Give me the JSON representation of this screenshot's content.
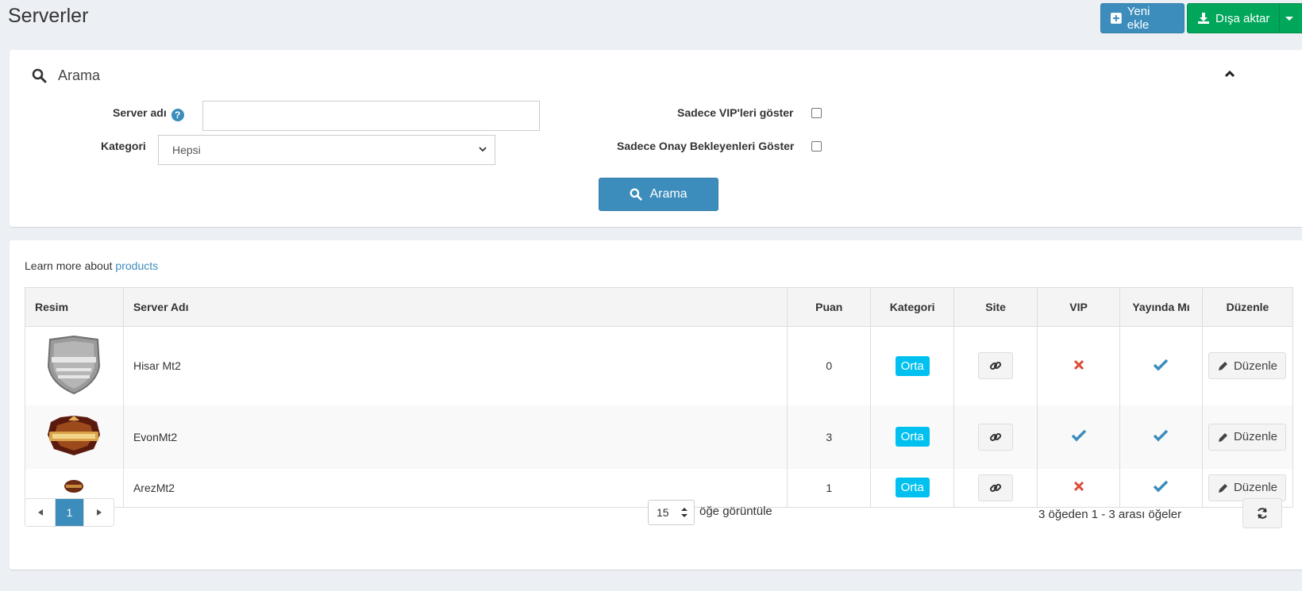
{
  "header": {
    "title": "Serverler",
    "new_button": "Yeni ekle",
    "export_button": "Dışa aktar"
  },
  "search": {
    "title": "Arama",
    "server_name_label": "Server adı",
    "server_name_value": "",
    "category_label": "Kategori",
    "category_selected": "Hepsi",
    "vip_only_label": "Sadece VIP'leri göster",
    "pending_only_label": "Sadece Onay Bekleyenleri Göster",
    "search_button": "Arama"
  },
  "list": {
    "learn_prefix": "Learn more about",
    "learn_link": "products",
    "columns": [
      "Resim",
      "Server Adı",
      "Puan",
      "Kategori",
      "Site",
      "VIP",
      "Yayında Mı",
      "Düzenle"
    ],
    "rows": [
      {
        "name": "Hisar Mt2",
        "score": "0",
        "category": "Orta",
        "vip": false,
        "published": true,
        "edit_label": "Düzenle"
      },
      {
        "name": "EvonMt2",
        "score": "3",
        "category": "Orta",
        "vip": true,
        "published": true,
        "edit_label": "Düzenle"
      },
      {
        "name": "ArezMt2",
        "score": "1",
        "category": "Orta",
        "vip": false,
        "published": true,
        "edit_label": "Düzenle"
      }
    ]
  },
  "pagination": {
    "current_page": "1",
    "page_size": "15",
    "page_size_label": "öğe görüntüle",
    "range_info": "3 öğeden 1 - 3 arası öğeler"
  },
  "colors": {
    "primary": "#3c8dbc",
    "success": "#00a65a",
    "info": "#00c0ef",
    "danger": "#dd4b39"
  }
}
